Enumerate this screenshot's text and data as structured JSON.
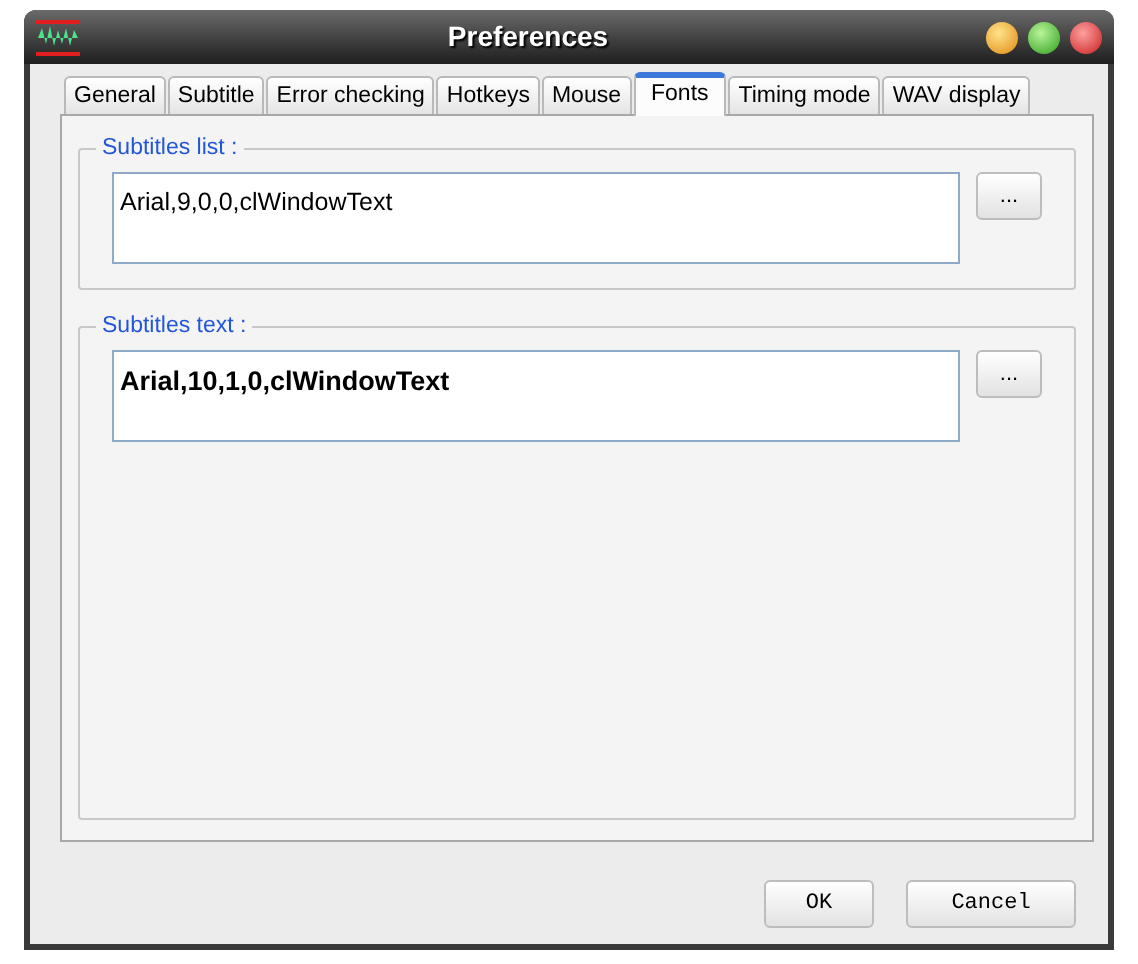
{
  "window": {
    "title": "Preferences"
  },
  "tabs": [
    {
      "label": "General",
      "selected": false
    },
    {
      "label": "Subtitle",
      "selected": false
    },
    {
      "label": "Error checking",
      "selected": false
    },
    {
      "label": "Hotkeys",
      "selected": false
    },
    {
      "label": "Mouse",
      "selected": false
    },
    {
      "label": "Fonts",
      "selected": true
    },
    {
      "label": "Timing mode",
      "selected": false
    },
    {
      "label": "WAV display",
      "selected": false
    }
  ],
  "groups": [
    {
      "legend": "Subtitles list :",
      "value": "Arial,9,0,0,clWindowText",
      "bold": false,
      "button": "..."
    },
    {
      "legend": "Subtitles text :",
      "value": "Arial,10,1,0,clWindowText",
      "bold": true,
      "button": "..."
    }
  ],
  "buttons": [
    "OK",
    "Cancel"
  ]
}
